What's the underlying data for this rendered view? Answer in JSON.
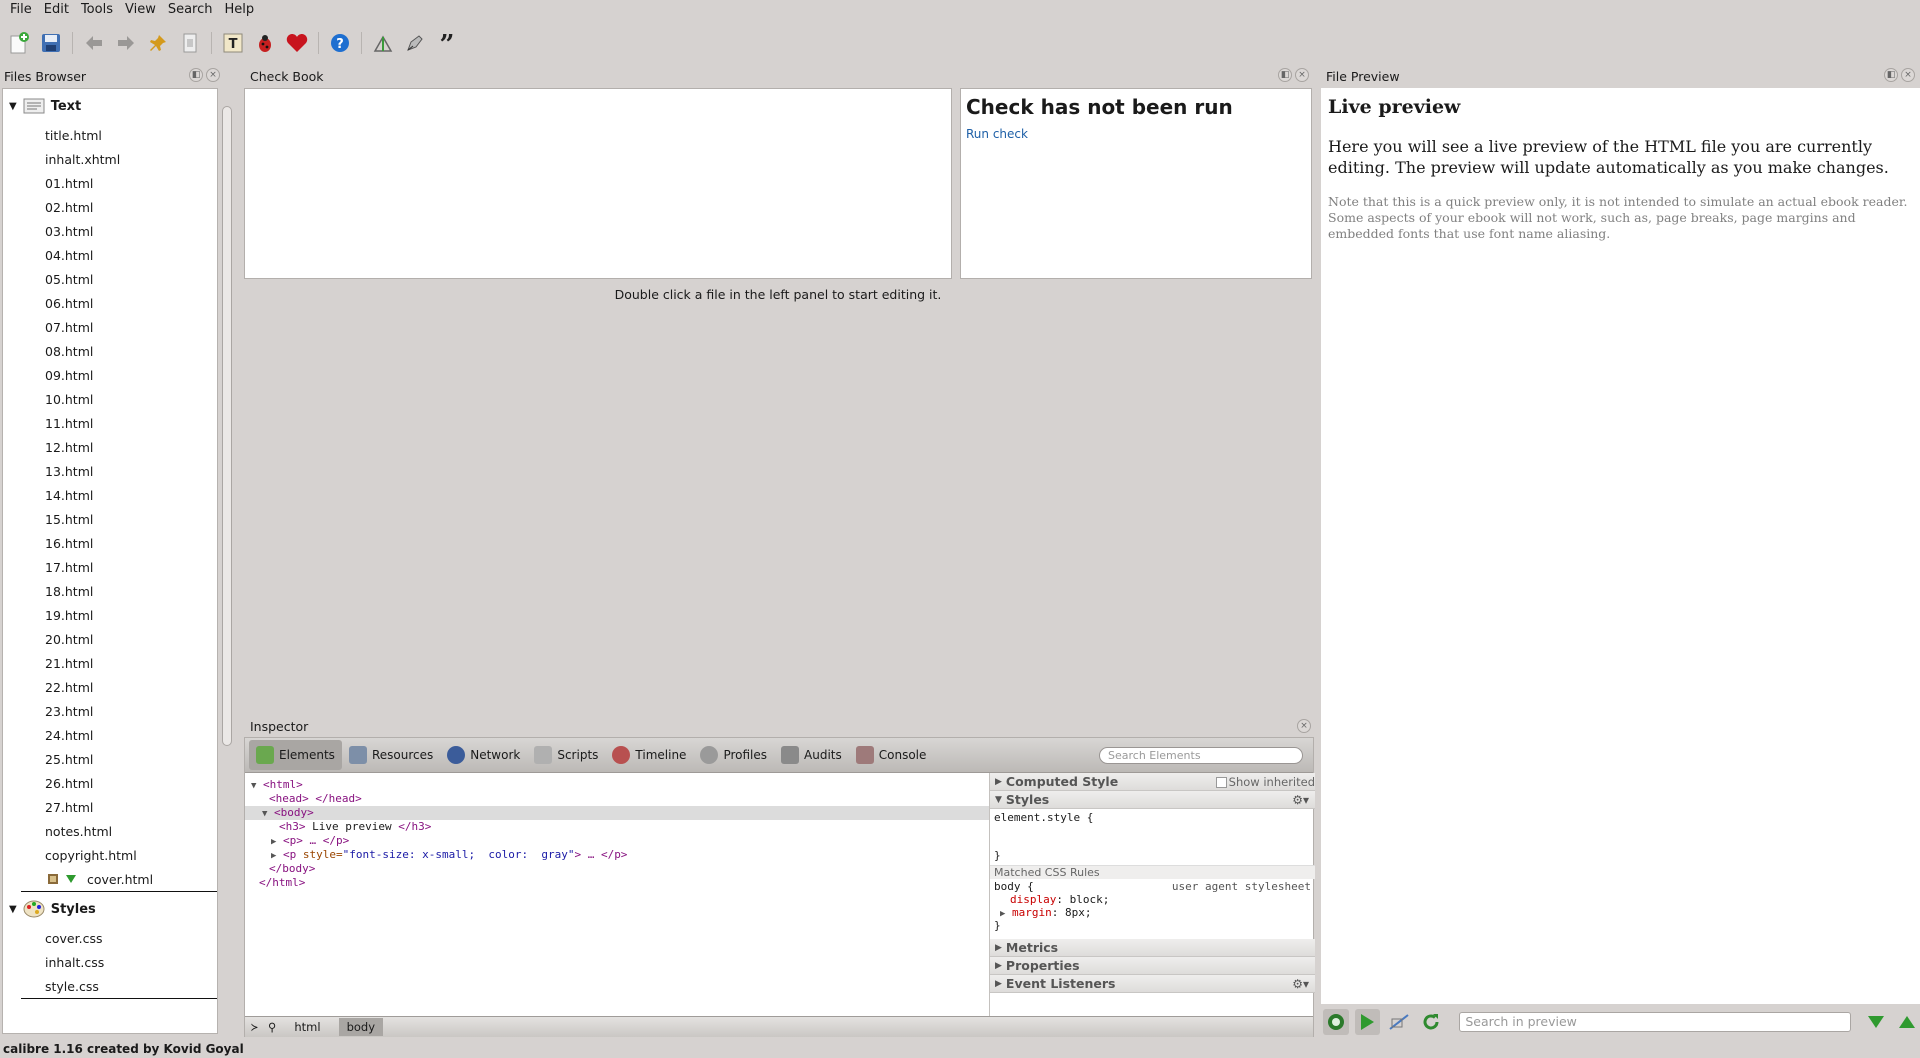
{
  "menubar": {
    "items": [
      "File",
      "Edit",
      "Tools",
      "View",
      "Search",
      "Help"
    ]
  },
  "panels": {
    "files_browser": "Files Browser",
    "check_book": "Check Book",
    "file_preview": "File Preview",
    "inspector": "Inspector"
  },
  "files": {
    "text_category": "Text",
    "text_files": [
      "title.html",
      "inhalt.xhtml",
      "01.html",
      "02.html",
      "03.html",
      "04.html",
      "05.html",
      "06.html",
      "07.html",
      "08.html",
      "09.html",
      "10.html",
      "11.html",
      "12.html",
      "13.html",
      "14.html",
      "15.html",
      "16.html",
      "17.html",
      "18.html",
      "19.html",
      "20.html",
      "21.html",
      "22.html",
      "23.html",
      "24.html",
      "25.html",
      "26.html",
      "27.html",
      "notes.html",
      "copyright.html"
    ],
    "cover_file": "cover.html",
    "styles_category": "Styles",
    "style_files": [
      "cover.css",
      "inhalt.css",
      "style.css"
    ]
  },
  "check": {
    "heading": "Check has not been run",
    "run_link": "Run check"
  },
  "editor_hint": "Double click a file in the left panel to start editing it.",
  "inspector": {
    "tabs": [
      "Elements",
      "Resources",
      "Network",
      "Scripts",
      "Timeline",
      "Profiles",
      "Audits",
      "Console"
    ],
    "search_placeholder": "Search Elements",
    "dom": {
      "html_open": "<html>",
      "head": "<head> </head>",
      "body_open": "<body>",
      "h3_open": "<h3>",
      "h3_text": " Live preview ",
      "h3_close": "</h3>",
      "p_line": "<p> … </p>",
      "p2_open": "<p",
      "p2_attr": " style=",
      "p2_val": "\"font-size: x-small;  color:  gray\"",
      "p2_rest": "> … </p>",
      "body_close": "</body>",
      "html_close": "</html>"
    },
    "styles": {
      "computed_style": "Computed Style",
      "show_inherited": "Show inherited",
      "styles": "Styles",
      "element_style_open": "element.style {",
      "close_brace": "}",
      "matched_rules": "Matched CSS Rules",
      "body_rule": "body {",
      "user_agent": "user agent stylesheet",
      "prop1_name": "display",
      "prop1_val": ": block;",
      "prop2_name": "margin",
      "prop2_val": ": 8px;",
      "metrics": "Metrics",
      "properties": "Properties",
      "event_listeners": "Event Listeners"
    },
    "breadcrumbs": [
      "html",
      "body"
    ]
  },
  "preview": {
    "h3": "Live preview",
    "p1": "Here you will see a live preview of the HTML file you are currently editing. The preview will update automatically as you make changes.",
    "p2": "Note that this is a quick preview only, it is not intended to simulate an actual ebook reader. Some aspects of your ebook will not work, such as, page breaks, page margins and embedded fonts that use font name aliasing.",
    "search_placeholder": "Search in preview"
  },
  "status": "calibre 1.16 created by Kovid Goyal",
  "colors": {
    "link": "#1d5fa7",
    "tag": "#881280",
    "attr_value": "#1a1aa6"
  }
}
